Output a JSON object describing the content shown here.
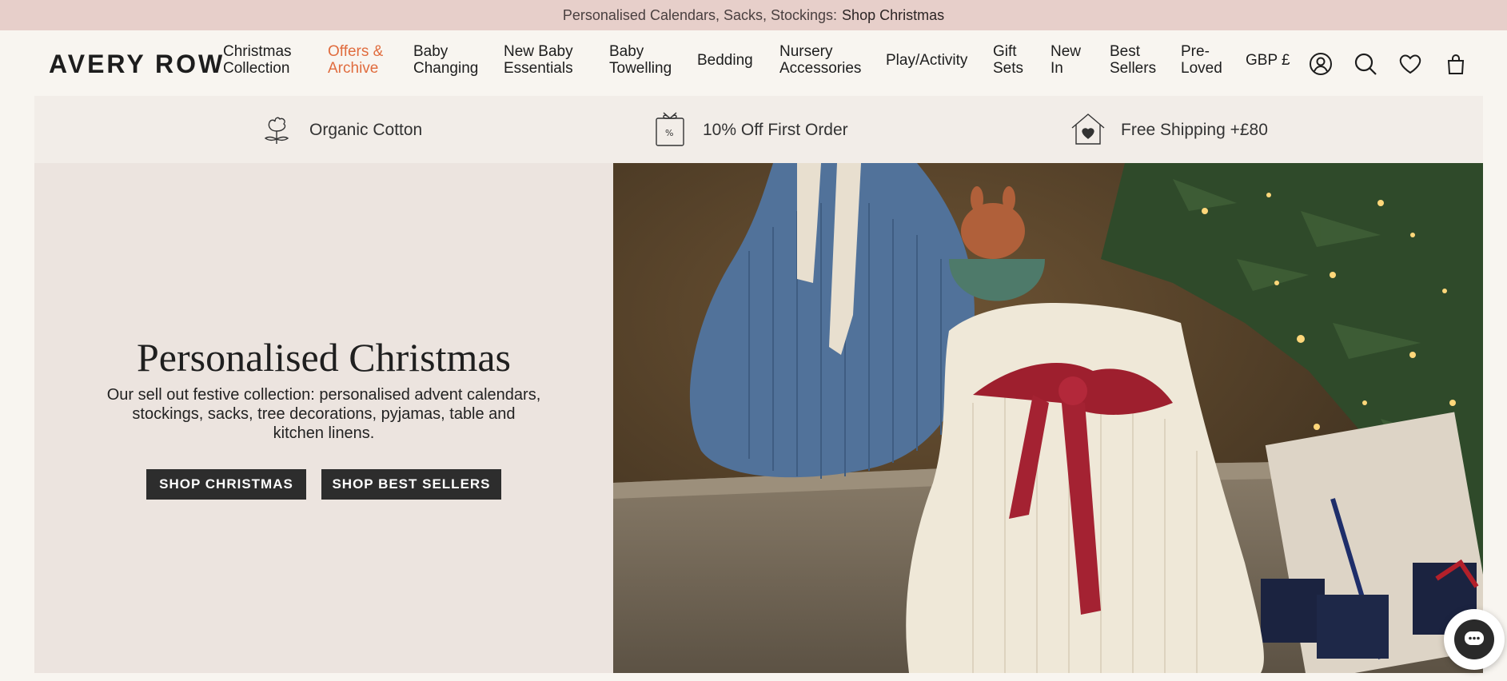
{
  "announcement": {
    "text": "Personalised Calendars, Sacks, Stockings:",
    "link": "Shop Christmas"
  },
  "header": {
    "logo": "AVERY ROW",
    "nav": [
      {
        "line1": "Christmas",
        "line2": "Collection"
      },
      {
        "line1": "Offers &",
        "line2": "Archive"
      },
      {
        "line1": "Baby",
        "line2": "Changing"
      },
      {
        "line1": "New Baby",
        "line2": "Essentials"
      },
      {
        "line1": "Baby",
        "line2": "Towelling"
      },
      {
        "line1": "Bedding",
        "line2": ""
      },
      {
        "line1": "Nursery",
        "line2": "Accessories"
      },
      {
        "line1": "Play/Activity",
        "line2": ""
      },
      {
        "line1": "Gift",
        "line2": "Sets"
      },
      {
        "line1": "New",
        "line2": "In"
      },
      {
        "line1": "Best",
        "line2": "Sellers"
      },
      {
        "line1": "Pre-",
        "line2": "Loved"
      }
    ],
    "currency": "GBP £",
    "icons": [
      "account-icon",
      "search-icon",
      "wishlist-heart-icon",
      "cart-bag-icon"
    ]
  },
  "usps": [
    {
      "icon": "cotton-flower-icon",
      "label": "Organic Cotton"
    },
    {
      "icon": "discount-tag-icon",
      "label": "10% Off First Order"
    },
    {
      "icon": "house-heart-icon",
      "label": "Free Shipping +£80"
    }
  ],
  "hero": {
    "title": "Personalised Christmas",
    "description": "Our sell out festive collection: personalised advent calendars, stockings, sacks, tree decorations, pyjamas, table and kitchen linens.",
    "buttons": [
      "SHOP CHRISTMAS",
      "SHOP BEST SELLERS"
    ]
  },
  "colors": {
    "accent": "#e06c3e",
    "announcement_bg": "#e7cfca",
    "button_bg": "#2d2d2d",
    "hero_bg": "#ece4df"
  }
}
